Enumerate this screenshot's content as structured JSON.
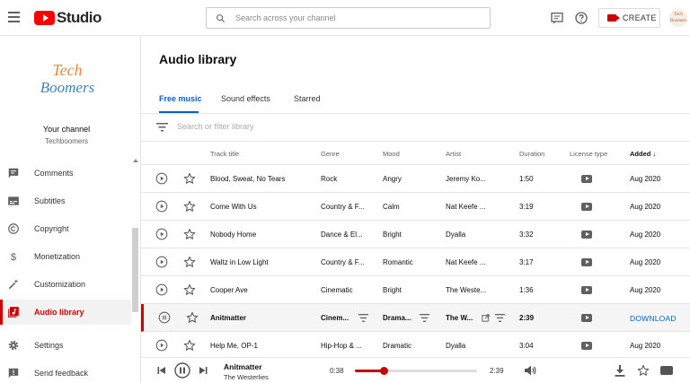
{
  "header": {
    "app_name": "Studio",
    "search_placeholder": "Search across your channel",
    "create_label": "CREATE",
    "avatar_text": "Tech Boomers"
  },
  "sidebar": {
    "channel_logo_line1": "Tech",
    "channel_logo_line2": "Boomers",
    "your_channel": "Your channel",
    "channel_name": "Techboomers",
    "items": [
      {
        "label": "Comments",
        "icon": "comment-icon"
      },
      {
        "label": "Subtitles",
        "icon": "subtitles-icon"
      },
      {
        "label": "Copyright",
        "icon": "copyright-icon"
      },
      {
        "label": "Monetization",
        "icon": "dollar-icon"
      },
      {
        "label": "Customization",
        "icon": "magic-wand-icon"
      },
      {
        "label": "Audio library",
        "icon": "audio-library-icon",
        "active": true
      },
      {
        "label": "Settings",
        "icon": "gear-icon"
      },
      {
        "label": "Send feedback",
        "icon": "feedback-icon"
      }
    ]
  },
  "main": {
    "title": "Audio library",
    "tabs": [
      "Free music",
      "Sound effects",
      "Starred"
    ],
    "active_tab": 0,
    "filter_placeholder": "Search or filter library"
  },
  "table": {
    "columns": [
      "Track title",
      "Genre",
      "Mood",
      "Artist",
      "Duration",
      "License type",
      "Added"
    ],
    "sort_column": "Added",
    "download_label": "DOWNLOAD",
    "rows": [
      {
        "title": "Blood, Sweat, No Tears",
        "genre": "Rock",
        "mood": "Angry",
        "artist": "Jeremy Ko...",
        "duration": "1:50",
        "added": "Aug 2020"
      },
      {
        "title": "Come With Us",
        "genre": "Country & F...",
        "mood": "Calm",
        "artist": "Nat Keefe ...",
        "duration": "3:19",
        "added": "Aug 2020"
      },
      {
        "title": "Nobody Home",
        "genre": "Dance & El...",
        "mood": "Bright",
        "artist": "Dyalla",
        "duration": "3:32",
        "added": "Aug 2020"
      },
      {
        "title": "Waltz in Low Light",
        "genre": "Country & F...",
        "mood": "Romantic",
        "artist": "Nat Keefe ...",
        "duration": "3:17",
        "added": "Aug 2020"
      },
      {
        "title": "Cooper Ave",
        "genre": "Cinematic",
        "mood": "Bright",
        "artist": "The Weste...",
        "duration": "1:36",
        "added": "Aug 2020"
      },
      {
        "title": "Anitmatter",
        "genre": "Cinem...",
        "mood": "Drama...",
        "artist": "The W...",
        "duration": "2:39",
        "added": "",
        "highlighted": true
      },
      {
        "title": "Help Me, OP-1",
        "genre": "Hip-Hop & ...",
        "mood": "Dramatic",
        "artist": "Dyalla",
        "duration": "3:04",
        "added": "Aug 2020"
      }
    ]
  },
  "player": {
    "title": "Anitmatter",
    "artist": "The Westerlies",
    "elapsed": "0:38",
    "total": "2:39",
    "progress_fraction": 0.24
  },
  "colors": {
    "brand_red": "#ff0000",
    "accent_red": "#cc0000",
    "link_blue": "#065fd4"
  }
}
